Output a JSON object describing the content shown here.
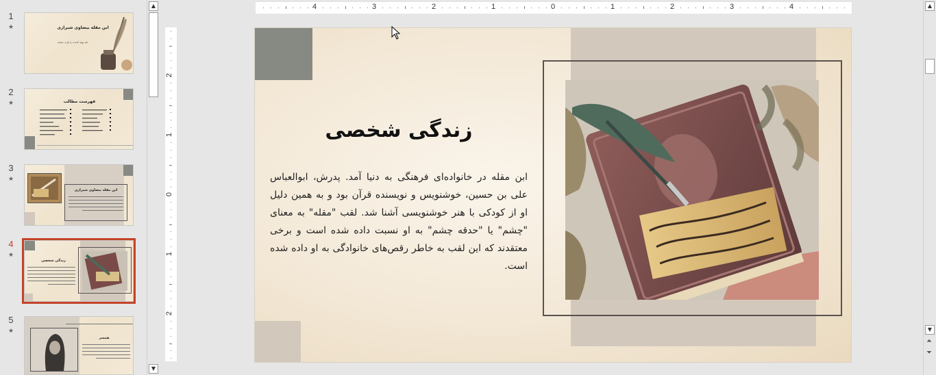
{
  "thumbnails": [
    {
      "number": "1",
      "star": "★",
      "title": "ابن مقله بیضاوی شیرازی",
      "subtitle": "نام تهیه کننده را وارد نمایید"
    },
    {
      "number": "2",
      "star": "★",
      "title": "فهرست مطالب"
    },
    {
      "number": "3",
      "star": "★",
      "title": "ابن مقله بیضاوی شیرازی"
    },
    {
      "number": "4",
      "star": "★",
      "title": "زندگی شخصی"
    },
    {
      "number": "5",
      "star": "★",
      "title": "همسر"
    }
  ],
  "selected_slide": "4",
  "ruler": {
    "horizontal": [
      "4",
      "3",
      "2",
      "1",
      "0",
      "1",
      "2",
      "3",
      "4"
    ],
    "vertical": [
      "2",
      "1",
      "0",
      "1",
      "2"
    ]
  },
  "slide": {
    "title": "زندگی شخصی",
    "body": "ابن مقله در خانواده‌ای فرهنگی به دنیا آمد. پدرش، ابوالعباس علی بن حسین، خوشنویس و نویسنده قرآن بود و به همین دلیل او از کودکی با هنر خوشنویسی آشنا شد. لقب \"مقله\" به معنای \"چشم\" یا \"حدقه چشم\" به او نسبت داده شده است و برخی معتقدند که این لقب به خاطر رقص‌های خانوادگی به او داده شده است."
  },
  "colors": {
    "selection": "#c4432a",
    "deco_dark": "#878a83",
    "deco_light": "#d2c8bc",
    "frame": "#5a5250"
  },
  "icons": {
    "scroll_up": "chevron-up-icon",
    "scroll_down": "chevron-down-icon",
    "prev_slide": "double-chevron-up-icon",
    "next_slide": "double-chevron-down-icon",
    "cursor": "mouse-pointer-icon"
  }
}
